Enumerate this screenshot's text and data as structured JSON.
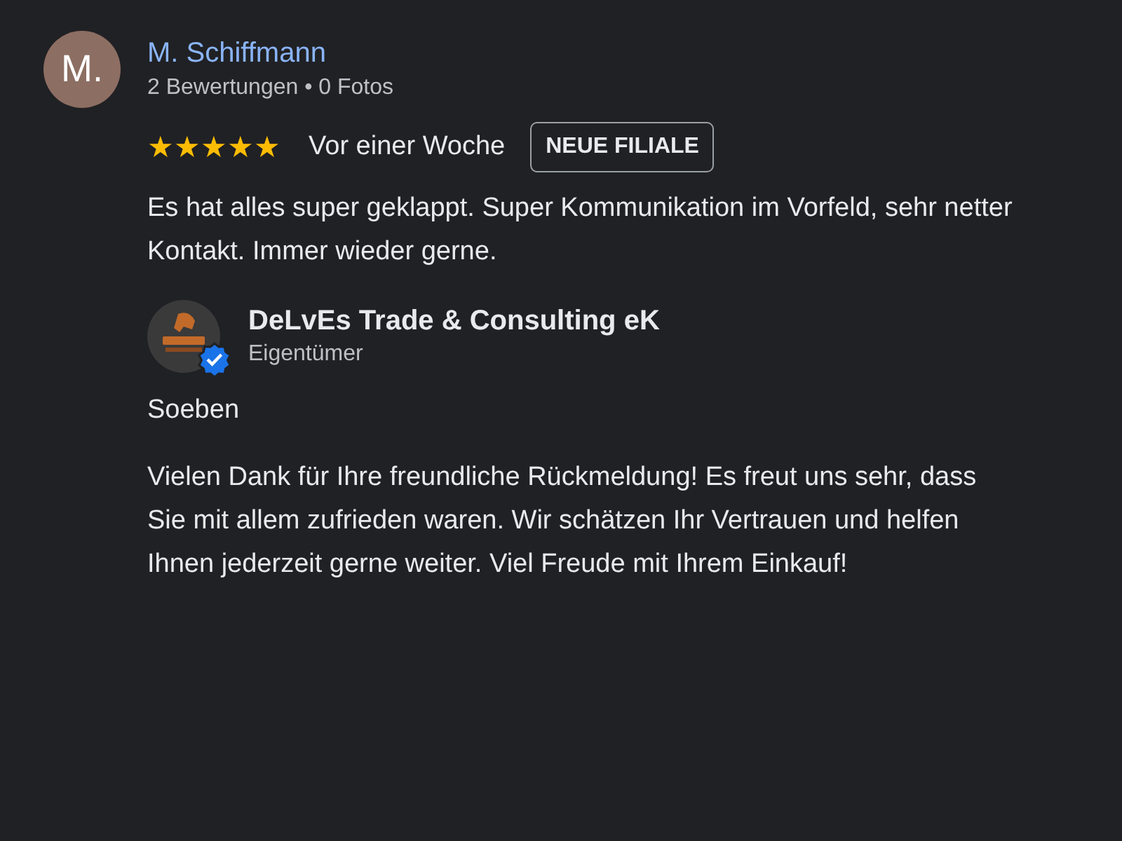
{
  "review": {
    "avatar_letter": "M.",
    "author": "M. Schiffmann",
    "author_meta": "2 Bewertungen • 0 Fotos",
    "stars": 5,
    "time": "Vor einer Woche",
    "badge": "NEUE FILIALE",
    "text": "Es hat alles super geklappt. Super Kommunikation im Vorfeld, sehr netter Kontakt. Immer wieder gerne."
  },
  "owner_reply": {
    "name": "DeLvEs Trade & Consulting eK",
    "role": "Eigentümer",
    "verified": true,
    "time": "Soeben",
    "text": "Vielen Dank für Ihre freundliche Rückmeldung! Es freut uns sehr, dass Sie mit allem zufrieden waren. Wir schätzen Ihr Vertrauen und helfen Ihnen jederzeit gerne weiter. Viel Freude mit Ihrem Einkauf!"
  }
}
